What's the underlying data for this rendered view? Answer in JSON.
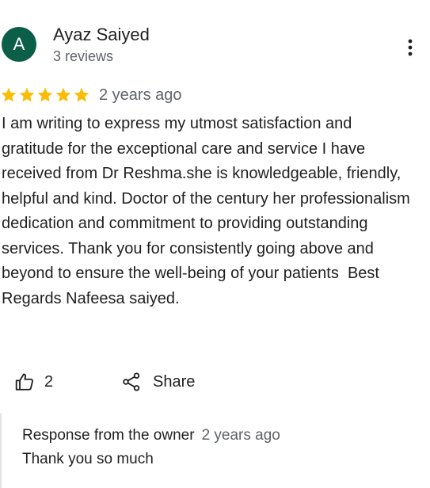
{
  "reviewer": {
    "avatar_letter": "A",
    "name": "Ayaz Saiyed",
    "reviews_count": "3 reviews"
  },
  "review": {
    "rating": 5,
    "max_rating": 5,
    "date": "2 years ago",
    "text": "I am writing to express my utmost satisfaction and gratitude for the exceptional care and service I have received from Dr Reshma.she is knowledgeable, friendly, helpful and kind. Doctor of the century her professionalism dedication and commitment to providing outstanding services. Thank you for consistently going above and beyond to ensure the well-being of your patients  Best Regards Nafeesa saiyed."
  },
  "actions": {
    "like_count": "2",
    "share_label": "Share"
  },
  "owner_response": {
    "title": "Response from the owner",
    "date": "2 years ago",
    "text": "Thank you so much"
  },
  "icons": {
    "more": "more-vertical-icon",
    "star": "star-icon",
    "like": "thumbs-up-icon",
    "share": "share-icon"
  },
  "colors": {
    "avatar_bg": "#0b5e48",
    "star": "#fbbc04",
    "secondary_text": "#5f6368",
    "primary_text": "#1f1f1f"
  }
}
